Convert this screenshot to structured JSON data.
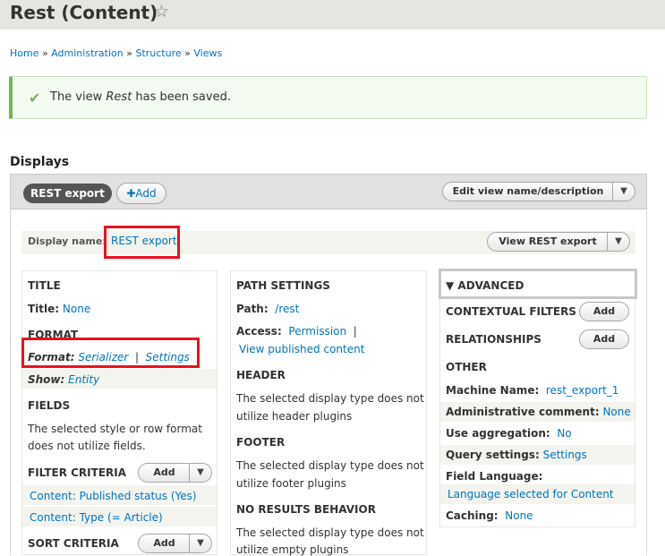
{
  "page": {
    "title": "Rest (Content)"
  },
  "breadcrumb": {
    "items": [
      "Home",
      "Administration",
      "Structure",
      "Views"
    ],
    "sep": "»"
  },
  "message": {
    "prefix": "The view ",
    "name": "Rest",
    "suffix": " has been saved."
  },
  "displays": {
    "heading": "Displays",
    "active_tab": "REST export",
    "add_label": "Add",
    "edit_label": "Edit view name/description"
  },
  "display_name": {
    "label": "Display name:",
    "value": "REST export",
    "view_button": "View REST export"
  },
  "col1": {
    "title_h": "TITLE",
    "title_label": "Title:",
    "title_value": "None",
    "format_h": "FORMAT",
    "format_label": "Format:",
    "format_value": "Serializer",
    "format_settings": "Settings",
    "show_label": "Show:",
    "show_value": "Entity",
    "fields_h": "FIELDS",
    "fields_text1": "The selected style or row format",
    "fields_text2": "does not utilize fields.",
    "filter_h": "FILTER CRITERIA",
    "filter_add": "Add",
    "filter1": "Content: Published status (Yes)",
    "filter2": "Content: Type (= Article)",
    "sort_h": "SORT CRITERIA",
    "sort_add": "Add"
  },
  "col2": {
    "path_h": "PATH SETTINGS",
    "path_label": "Path:",
    "path_value": "/rest",
    "access_label": "Access:",
    "access_value": "Permission",
    "view_published": "View published content",
    "header_h": "HEADER",
    "header_t1": "The selected display type does not",
    "header_t2": "utilize header plugins",
    "footer_h": "FOOTER",
    "footer_t1": "The selected display type does not",
    "footer_t2": "utilize footer plugins",
    "noresults_h": "NO RESULTS BEHAVIOR",
    "noresults_t1": "The selected display type does not",
    "noresults_t2": "utilize empty plugins"
  },
  "col3": {
    "advanced_h": "ADVANCED",
    "contextual_h": "CONTEXTUAL FILTERS",
    "contextual_add": "Add",
    "relationships_h": "RELATIONSHIPS",
    "relationships_add": "Add",
    "other_h": "OTHER",
    "machine_label": "Machine Name:",
    "machine_value": "rest_export_1",
    "admin_label": "Administrative comment:",
    "admin_value": "None",
    "agg_label": "Use aggregation:",
    "agg_value": "No",
    "query_label": "Query settings:",
    "query_value": "Settings",
    "lang_label": "Field Language:",
    "lang_value": "Language selected for Content",
    "cache_label": "Caching:",
    "cache_value": "None"
  }
}
